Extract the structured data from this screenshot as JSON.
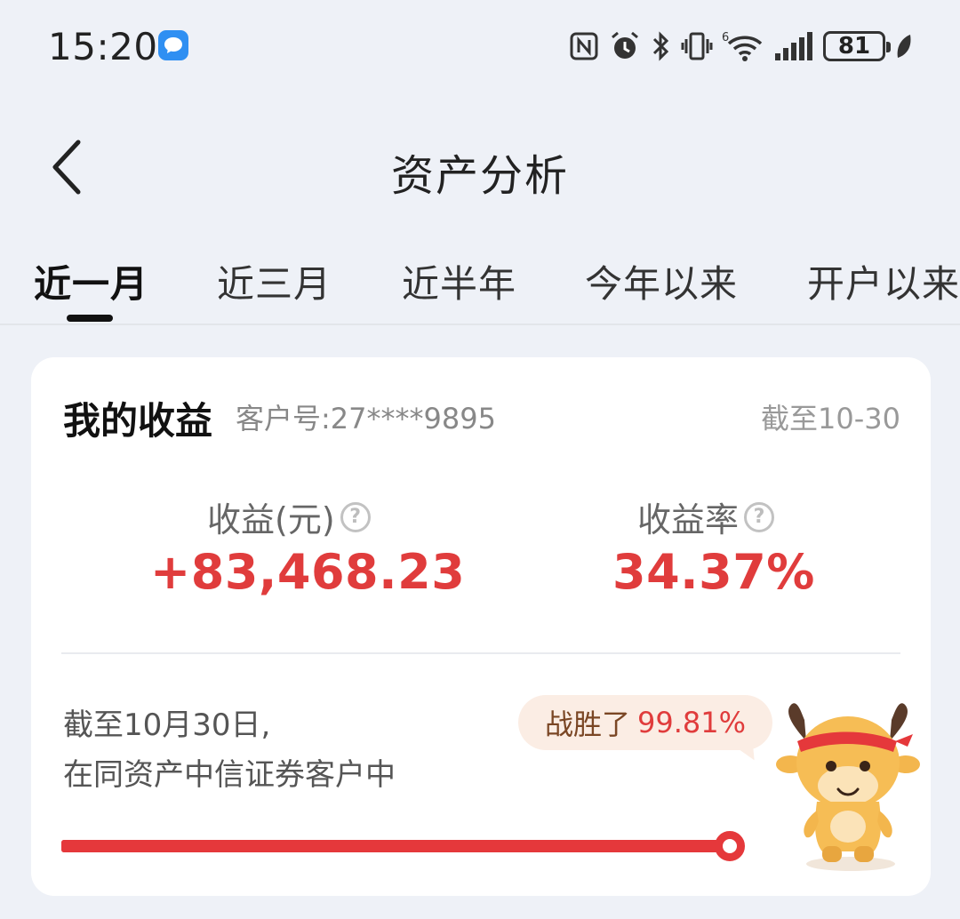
{
  "status_bar": {
    "time": "15:20",
    "battery": "81",
    "icons": [
      "message-app-icon",
      "nfc-icon",
      "alarm-icon",
      "bluetooth-icon",
      "vibrate-icon",
      "wifi-6-icon",
      "cellular-signal-icon",
      "battery-icon",
      "eco-leaf-icon"
    ]
  },
  "header": {
    "title": "资产分析",
    "back_icon": "chevron-left-icon"
  },
  "tabs": [
    {
      "label": "近一月",
      "active": true
    },
    {
      "label": "近三月",
      "active": false
    },
    {
      "label": "近半年",
      "active": false
    },
    {
      "label": "今年以来",
      "active": false
    },
    {
      "label": "开户以来",
      "active": false
    }
  ],
  "card": {
    "title": "我的收益",
    "customer_no": "客户号:27****9895",
    "as_of": "截至10-30",
    "profit": {
      "label": "收益(元)",
      "value": "+83,468.23"
    },
    "profit_rate": {
      "label": "收益率",
      "value": "34.37%"
    },
    "ranking": {
      "line1": "截至10月30日,",
      "line2": "在同资产中信证券客户中",
      "beat_label": "战胜了",
      "beat_value": "99.81%",
      "beat_fraction": 0.9981
    }
  },
  "colors": {
    "accent_red": "#e03c3c",
    "bubble_bg": "#fbede4",
    "page_bg": "#eef1f7"
  }
}
